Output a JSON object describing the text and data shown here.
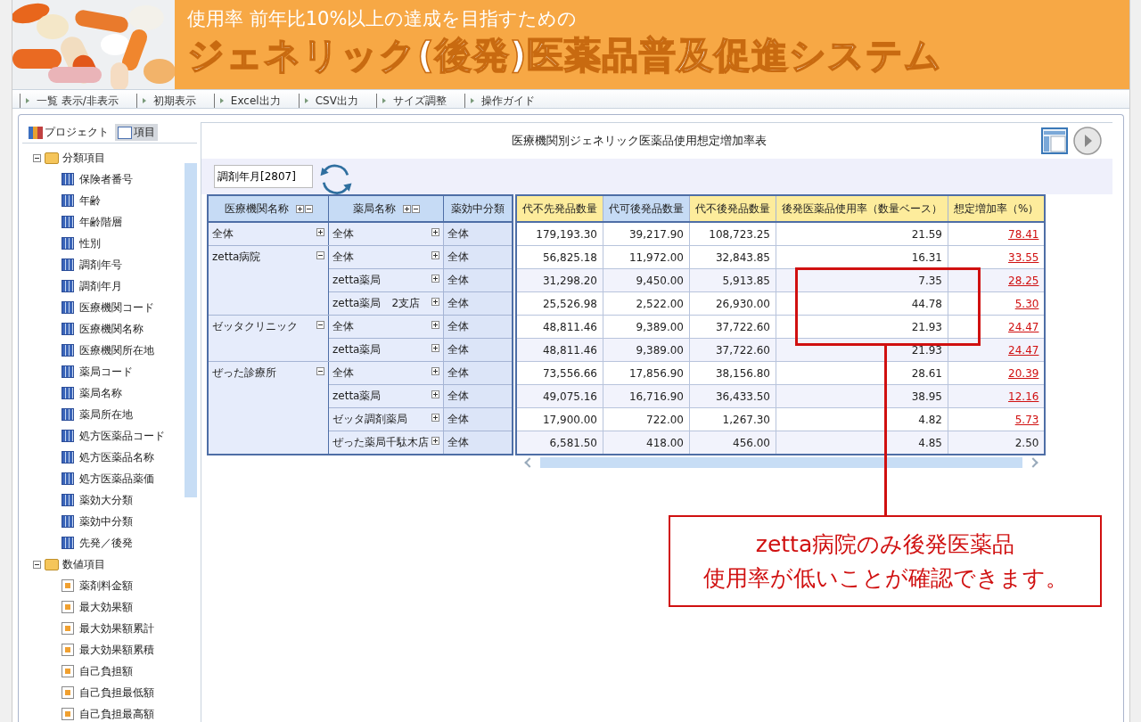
{
  "banner": {
    "subtitle": "使用率 前年比10%以上の達成を目指すための",
    "title": "ジェネリック(後発)医薬品普及促進システム"
  },
  "toolbar": [
    "一覧 表示/非表示",
    "初期表示",
    "Excel出力",
    "CSV出力",
    "サイズ調整",
    "操作ガイド"
  ],
  "sidebar": {
    "tabs": [
      {
        "label": "プロジェクト",
        "selected": false
      },
      {
        "label": "項目",
        "selected": true
      }
    ],
    "tree": [
      {
        "label": "分類項目",
        "kind": "category",
        "expanded": true,
        "children": [
          "保険者番号",
          "年齢",
          "年齢階層",
          "性別",
          "調剤年号",
          "調剤年月",
          "医療機関コード",
          "医療機関名称",
          "医療機関所在地",
          "薬局コード",
          "薬局名称",
          "薬局所在地",
          "処方医薬品コード",
          "処方医薬品名称",
          "処方医薬品薬価",
          "薬効大分類",
          "薬効中分類",
          "先発／後発"
        ]
      },
      {
        "label": "数値項目",
        "kind": "numeric",
        "expanded": true,
        "children": [
          "薬剤料金額",
          "最大効果額",
          "最大効果額累計",
          "最大効果額累積",
          "自己負担額",
          "自己負担最低額",
          "自己負担最高額"
        ]
      }
    ]
  },
  "report": {
    "title": "医療機関別ジェネリック医薬品使用想定増加率表",
    "filter": "調剤年月[2807]",
    "row_headers": [
      {
        "label": "医療機関名称",
        "toggles": true
      },
      {
        "label": "薬局名称",
        "toggles": true
      },
      {
        "label": "薬効中分類",
        "toggles": false
      }
    ],
    "columns": [
      {
        "label": "代不先発品数量",
        "highlighted": false
      },
      {
        "label": "代可後発品数量",
        "highlighted": true
      },
      {
        "label": "代不後発品数量",
        "highlighted": false
      },
      {
        "label": "後発医薬品使用率（数量ベース）",
        "highlighted": false
      },
      {
        "label": "想定増加率（%）",
        "highlighted": false
      }
    ],
    "groups": [
      {
        "name": "全体",
        "expanded": false,
        "rows": [
          {
            "pharmacy": "全体",
            "category": "全体",
            "values": [
              "179,193.30",
              "39,217.90",
              "108,723.25",
              "21.59"
            ],
            "rate": "78.41",
            "rate_link": true
          }
        ]
      },
      {
        "name": "zetta病院",
        "expanded": true,
        "rows": [
          {
            "pharmacy": "全体",
            "category": "全体",
            "values": [
              "56,825.18",
              "11,972.00",
              "32,843.85",
              "16.31"
            ],
            "rate": "33.55",
            "rate_link": true
          },
          {
            "pharmacy": "zetta薬局",
            "category": "全体",
            "values": [
              "31,298.20",
              "9,450.00",
              "5,913.85",
              "7.35"
            ],
            "rate": "28.25",
            "rate_link": true
          },
          {
            "pharmacy": "zetta薬局　2支店",
            "category": "全体",
            "values": [
              "25,526.98",
              "2,522.00",
              "26,930.00",
              "44.78"
            ],
            "rate": "5.30",
            "rate_link": true
          }
        ]
      },
      {
        "name": "ゼッタクリニック",
        "expanded": true,
        "rows": [
          {
            "pharmacy": "全体",
            "category": "全体",
            "values": [
              "48,811.46",
              "9,389.00",
              "37,722.60",
              "21.93"
            ],
            "rate": "24.47",
            "rate_link": true
          },
          {
            "pharmacy": "zetta薬局",
            "category": "全体",
            "values": [
              "48,811.46",
              "9,389.00",
              "37,722.60",
              "21.93"
            ],
            "rate": "24.47",
            "rate_link": true
          }
        ]
      },
      {
        "name": "ぜった診療所",
        "expanded": true,
        "rows": [
          {
            "pharmacy": "全体",
            "category": "全体",
            "values": [
              "73,556.66",
              "17,856.90",
              "38,156.80",
              "28.61"
            ],
            "rate": "20.39",
            "rate_link": true
          },
          {
            "pharmacy": "zetta薬局",
            "category": "全体",
            "values": [
              "49,075.16",
              "16,716.90",
              "36,433.50",
              "38.95"
            ],
            "rate": "12.16",
            "rate_link": true
          },
          {
            "pharmacy": "ゼッタ調剤薬局",
            "category": "全体",
            "values": [
              "17,900.00",
              "722.00",
              "1,267.30",
              "4.82"
            ],
            "rate": "5.73",
            "rate_link": true
          },
          {
            "pharmacy": "ぜった薬局千駄木店",
            "category": "全体",
            "values": [
              "6,581.50",
              "418.00",
              "456.00",
              "4.85"
            ],
            "rate": "2.50",
            "rate_link": false
          }
        ]
      }
    ]
  },
  "annotation": {
    "lines": [
      "zetta病院のみ後発医薬品",
      "使用率が低いことが確認できます。"
    ]
  }
}
